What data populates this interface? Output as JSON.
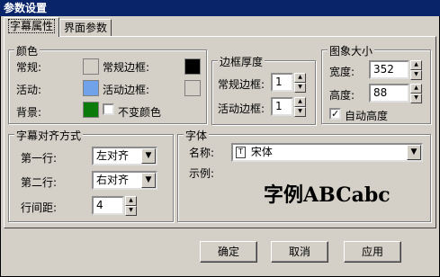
{
  "window": {
    "title": "参数设置"
  },
  "tabs": [
    {
      "label": "字幕属性"
    },
    {
      "label": "界面参数"
    }
  ],
  "colors": {
    "title": "颜色",
    "normal_label": "常规:",
    "active_label": "活动:",
    "background_label": "背景:",
    "normal_border_label": "常规边框:",
    "active_border_label": "活动边框:",
    "fixed_color_label": "不变颜色",
    "normal_color": "#d4d0c8",
    "active_color": "#6fa2e8",
    "background_color": "#0a7a0a",
    "normal_border_color": "#000000",
    "active_border_color": "#d4d0c8"
  },
  "border_thickness": {
    "title": "边框厚度",
    "normal_label": "常规边框:",
    "normal_value": "1",
    "active_label": "活动边框:",
    "active_value": "1"
  },
  "icon_size": {
    "title": "图象大小",
    "width_label": "宽度:",
    "width_value": "352",
    "height_label": "高度:",
    "height_value": "88",
    "auto_height_label": "自动高度"
  },
  "alignment": {
    "title": "字幕对齐方式",
    "line1_label": "第一行:",
    "line1_value": "左对齐",
    "line2_label": "第二行:",
    "line2_value": "右对齐",
    "spacing_label": "行间距:",
    "spacing_value": "4"
  },
  "font": {
    "title": "字体",
    "name_label": "名称:",
    "name_value": "宋体",
    "sample_label": "示例:",
    "sample_text": "字例ABCabc"
  },
  "buttons": {
    "ok": "确定",
    "cancel": "取消",
    "apply": "应用"
  }
}
